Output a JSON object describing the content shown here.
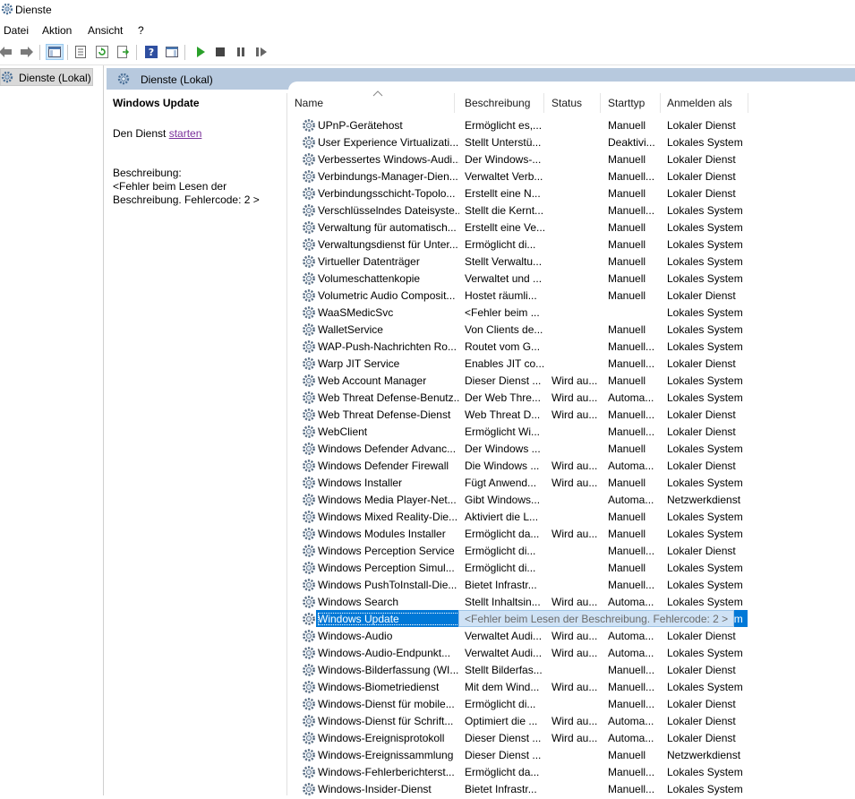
{
  "window": {
    "title": "Dienste"
  },
  "menu": [
    "Datei",
    "Aktion",
    "Ansicht",
    "?"
  ],
  "tree": {
    "selected": "Dienste (Lokal)"
  },
  "header": {
    "title": "Dienste (Lokal)"
  },
  "detail": {
    "service_name": "Windows Update",
    "action_prefix": "Den Dienst ",
    "action_link": "starten",
    "desc_label": "Beschreibung:",
    "desc_text": "<Fehler beim Lesen der Beschreibung. Fehlercode: 2 >"
  },
  "columns": [
    "Name",
    "Beschreibung",
    "Status",
    "Starttyp",
    "Anmelden als"
  ],
  "services": [
    {
      "name": "UPnP-Gerätehost",
      "desc": "Ermöglicht es,...",
      "status": "",
      "start": "Manuell",
      "logon": "Lokaler Dienst"
    },
    {
      "name": "User Experience Virtualizati...",
      "desc": "Stellt Unterstü...",
      "status": "",
      "start": "Deaktivi...",
      "logon": "Lokales System"
    },
    {
      "name": "Verbessertes Windows-Audi...",
      "desc": "Der Windows-...",
      "status": "",
      "start": "Manuell",
      "logon": "Lokaler Dienst"
    },
    {
      "name": "Verbindungs-Manager-Dien...",
      "desc": "Verwaltet Verb...",
      "status": "",
      "start": "Manuell...",
      "logon": "Lokaler Dienst"
    },
    {
      "name": "Verbindungsschicht-Topolo...",
      "desc": "Erstellt eine N...",
      "status": "",
      "start": "Manuell",
      "logon": "Lokaler Dienst"
    },
    {
      "name": "Verschlüsselndes Dateisyste...",
      "desc": "Stellt die Kernt...",
      "status": "",
      "start": "Manuell...",
      "logon": "Lokales System"
    },
    {
      "name": "Verwaltung für automatisch...",
      "desc": "Erstellt eine Ve...",
      "status": "",
      "start": "Manuell",
      "logon": "Lokales System"
    },
    {
      "name": "Verwaltungsdienst für Unter...",
      "desc": "Ermöglicht di...",
      "status": "",
      "start": "Manuell",
      "logon": "Lokales System"
    },
    {
      "name": "Virtueller Datenträger",
      "desc": "Stellt Verwaltu...",
      "status": "",
      "start": "Manuell",
      "logon": "Lokales System"
    },
    {
      "name": "Volumeschattenkopie",
      "desc": "Verwaltet und ...",
      "status": "",
      "start": "Manuell",
      "logon": "Lokales System"
    },
    {
      "name": "Volumetric Audio Composit...",
      "desc": "Hostet räumli...",
      "status": "",
      "start": "Manuell",
      "logon": "Lokaler Dienst"
    },
    {
      "name": "WaaSMedicSvc",
      "desc": "<Fehler beim ...",
      "status": "",
      "start": "",
      "logon": "Lokales System"
    },
    {
      "name": "WalletService",
      "desc": "Von Clients de...",
      "status": "",
      "start": "Manuell",
      "logon": "Lokales System"
    },
    {
      "name": "WAP-Push-Nachrichten Ro...",
      "desc": "Routet vom G...",
      "status": "",
      "start": "Manuell...",
      "logon": "Lokales System"
    },
    {
      "name": "Warp JIT Service",
      "desc": "Enables JIT co...",
      "status": "",
      "start": "Manuell...",
      "logon": "Lokaler Dienst"
    },
    {
      "name": "Web Account Manager",
      "desc": "Dieser Dienst ...",
      "status": "Wird au...",
      "start": "Manuell",
      "logon": "Lokales System"
    },
    {
      "name": "Web Threat Defense-Benutz...",
      "desc": "Der Web Thre...",
      "status": "Wird au...",
      "start": "Automa...",
      "logon": "Lokales System"
    },
    {
      "name": "Web Threat Defense-Dienst",
      "desc": "Web Threat D...",
      "status": "Wird au...",
      "start": "Manuell...",
      "logon": "Lokaler Dienst"
    },
    {
      "name": "WebClient",
      "desc": "Ermöglicht Wi...",
      "status": "",
      "start": "Manuell...",
      "logon": "Lokaler Dienst"
    },
    {
      "name": "Windows Defender Advanc...",
      "desc": "Der Windows ...",
      "status": "",
      "start": "Manuell",
      "logon": "Lokales System"
    },
    {
      "name": "Windows Defender Firewall",
      "desc": "Die Windows ...",
      "status": "Wird au...",
      "start": "Automa...",
      "logon": "Lokaler Dienst"
    },
    {
      "name": "Windows Installer",
      "desc": "Fügt Anwend...",
      "status": "Wird au...",
      "start": "Manuell",
      "logon": "Lokales System"
    },
    {
      "name": "Windows Media Player-Net...",
      "desc": "Gibt Windows...",
      "status": "",
      "start": "Automa...",
      "logon": "Netzwerkdienst"
    },
    {
      "name": "Windows Mixed Reality-Die...",
      "desc": "Aktiviert die L...",
      "status": "",
      "start": "Manuell",
      "logon": "Lokales System"
    },
    {
      "name": "Windows Modules Installer",
      "desc": "Ermöglicht da...",
      "status": "Wird au...",
      "start": "Manuell",
      "logon": "Lokales System"
    },
    {
      "name": "Windows Perception Service",
      "desc": "Ermöglicht di...",
      "status": "",
      "start": "Manuell...",
      "logon": "Lokaler Dienst"
    },
    {
      "name": "Windows Perception Simul...",
      "desc": "Ermöglicht di...",
      "status": "",
      "start": "Manuell",
      "logon": "Lokales System"
    },
    {
      "name": "Windows PushToInstall-Die...",
      "desc": "Bietet Infrastr...",
      "status": "",
      "start": "Manuell...",
      "logon": "Lokales System"
    },
    {
      "name": "Windows Search",
      "desc": "Stellt Inhaltsin...",
      "status": "Wird au...",
      "start": "Automa...",
      "logon": "Lokales System"
    },
    {
      "name": "Windows Update",
      "desc": "",
      "status": "",
      "start": "",
      "logon": "Lokales System",
      "selected": true,
      "tooltip": "<Fehler beim Lesen der Beschreibung. Fehlercode: 2 >"
    },
    {
      "name": "Windows-Audio",
      "desc": "Verwaltet Audi...",
      "status": "Wird au...",
      "start": "Automa...",
      "logon": "Lokaler Dienst"
    },
    {
      "name": "Windows-Audio-Endpunkt...",
      "desc": "Verwaltet Audi...",
      "status": "Wird au...",
      "start": "Automa...",
      "logon": "Lokales System"
    },
    {
      "name": "Windows-Bilderfassung (WI...",
      "desc": "Stellt Bilderfas...",
      "status": "",
      "start": "Manuell...",
      "logon": "Lokaler Dienst"
    },
    {
      "name": "Windows-Biometriedienst",
      "desc": "Mit dem Wind...",
      "status": "Wird au...",
      "start": "Manuell...",
      "logon": "Lokales System"
    },
    {
      "name": "Windows-Dienst für mobile...",
      "desc": "Ermöglicht di...",
      "status": "",
      "start": "Manuell...",
      "logon": "Lokaler Dienst"
    },
    {
      "name": "Windows-Dienst für Schrift...",
      "desc": "Optimiert die ...",
      "status": "Wird au...",
      "start": "Automa...",
      "logon": "Lokaler Dienst"
    },
    {
      "name": "Windows-Ereignisprotokoll",
      "desc": "Dieser Dienst ...",
      "status": "Wird au...",
      "start": "Automa...",
      "logon": "Lokaler Dienst"
    },
    {
      "name": "Windows-Ereignissammlung",
      "desc": "Dieser Dienst ...",
      "status": "",
      "start": "Manuell",
      "logon": "Netzwerkdienst"
    },
    {
      "name": "Windows-Fehlerberichterst...",
      "desc": "Ermöglicht da...",
      "status": "",
      "start": "Manuell...",
      "logon": "Lokales System"
    },
    {
      "name": "Windows-Insider-Dienst",
      "desc": "Bietet Infrastr...",
      "status": "",
      "start": "Manuell...",
      "logon": "Lokales System"
    }
  ],
  "colors": {
    "selection": "#0078d7",
    "header_strip": "#b7c9de",
    "link": "#7a2f9a"
  }
}
